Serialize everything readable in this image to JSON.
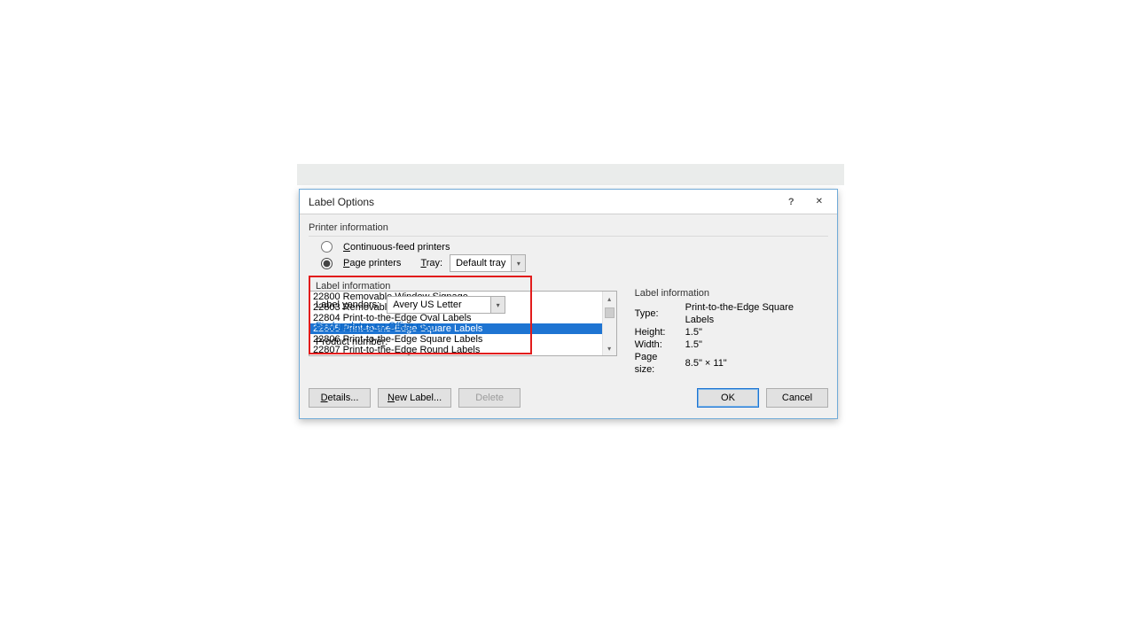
{
  "dialog": {
    "title": "Label Options",
    "help": "?",
    "close": "✕"
  },
  "printer": {
    "heading": "Printer information",
    "continuous_label_pre": "C",
    "continuous_label_post": "ontinuous-feed printers",
    "page_label_pre": "P",
    "page_label_post": "age printers",
    "tray_label_pre": "T",
    "tray_label_post": "ray:",
    "tray_value": "Default tray"
  },
  "labelinfo": {
    "heading": "Label information",
    "vendor_label_pre": "Label ",
    "vendor_label_u": "v",
    "vendor_label_post": "endors:",
    "vendor_value": "Avery US Letter",
    "link": "Find updates on Office.com",
    "product_label_pre": "Product numbe",
    "product_label_u": "r",
    "product_label_post": ":"
  },
  "products": [
    "22800 Removable Window Signage",
    "22803 Removable Shelf Tags",
    "22804 Print-to-the-Edge Oval Labels",
    "22805 Print-to-the-Edge Square Labels",
    "22806 Print-to-the-Edge Square Labels",
    "22807 Print-to-the-Edge Round Labels"
  ],
  "selected_index": 3,
  "info": {
    "heading": "Label information",
    "type_label": "Type:",
    "type_value": "Print-to-the-Edge Square Labels",
    "height_label": "Height:",
    "height_value": "1.5\"",
    "width_label": "Width:",
    "width_value": "1.5\"",
    "page_label": "Page size:",
    "page_value": "8.5\" × 11\""
  },
  "buttons": {
    "details_pre": "D",
    "details_post": "etails...",
    "newlabel_pre": "N",
    "newlabel_post": "ew Label...",
    "delete": "Delete",
    "ok": "OK",
    "cancel": "Cancel"
  }
}
